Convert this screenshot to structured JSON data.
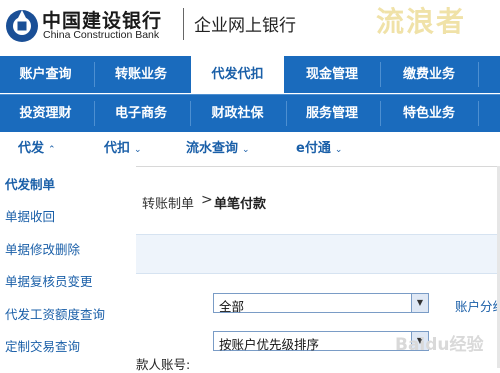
{
  "header": {
    "brand_cn": "中国建设银行",
    "brand_en": "China Construction Bank",
    "product": "企业网上银行",
    "watermark": "流浪者"
  },
  "nav_row1": [
    {
      "label": "账户查询",
      "active": false
    },
    {
      "label": "转账业务",
      "active": false
    },
    {
      "label": "代发代扣",
      "active": true
    },
    {
      "label": "现金管理",
      "active": false
    },
    {
      "label": "缴费业务",
      "active": false
    }
  ],
  "nav_row2": [
    {
      "label": "投资理财"
    },
    {
      "label": "电子商务"
    },
    {
      "label": "财政社保"
    },
    {
      "label": "服务管理"
    },
    {
      "label": "特色业务"
    }
  ],
  "subnav": [
    {
      "label": "代发",
      "caret": "^"
    },
    {
      "label": "代扣",
      "caret": "v"
    },
    {
      "label": "流水查询",
      "caret": "v"
    },
    {
      "label": "e付通",
      "caret": "v"
    }
  ],
  "sidebar": [
    {
      "label": "代发制单",
      "active": true
    },
    {
      "label": "单据收回"
    },
    {
      "label": "单据修改删除"
    },
    {
      "label": "单据复核员变更"
    },
    {
      "label": "代发工资额度查询"
    },
    {
      "label": "定制交易查询"
    }
  ],
  "breadcrumb": {
    "parent": "转账制单",
    "separator": ">",
    "current": "单笔付款"
  },
  "form": {
    "select1_value": "全部",
    "select2_value": "按账户优先级排序",
    "right_link": "账户分组",
    "partial_label": "款人账号:"
  },
  "footer_watermark": "Baidu经验",
  "colors": {
    "nav_bg": "#1a6bbd",
    "link": "#1a5fa8",
    "band": "#eef4fb"
  }
}
